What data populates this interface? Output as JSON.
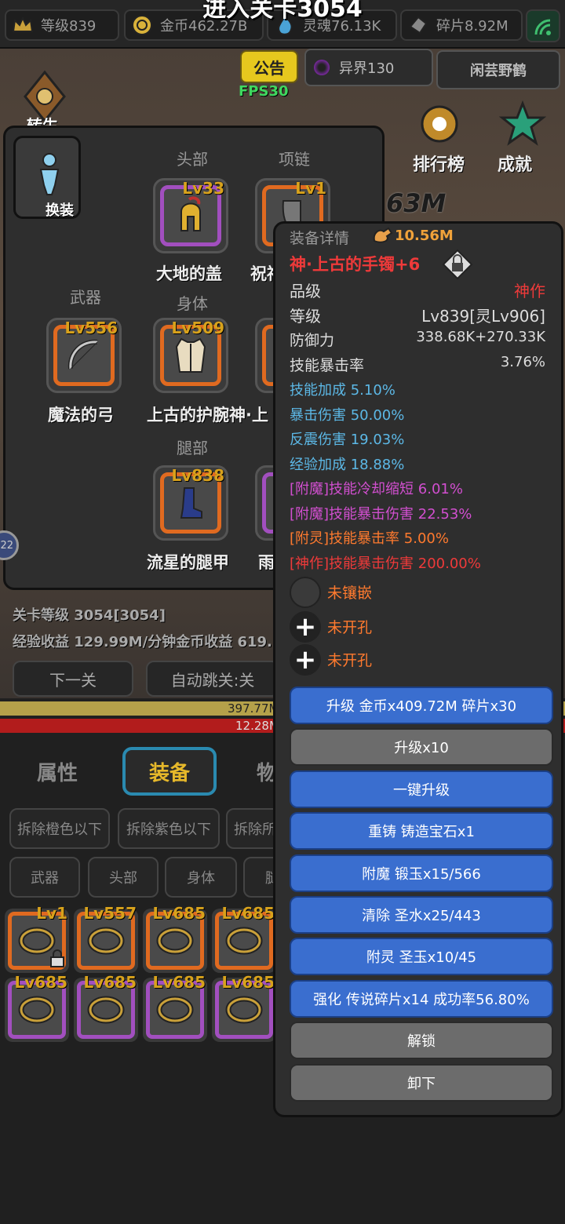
{
  "overlay_title": "进入关卡3054",
  "topbar": {
    "level": "等级839",
    "gold": "金币462.27B",
    "soul": "灵魂76.13K",
    "shard": "碎片8.92M"
  },
  "secondbar": {
    "notice": "公告",
    "otherworld": "异界130",
    "player": "闲芸野鹤",
    "fps": "FPS30"
  },
  "background_labels": {
    "rank": "排行榜",
    "achievement": "成就",
    "frag_value": "63M",
    "left_text": "转生"
  },
  "equip_panel": {
    "swap_label": "换装",
    "slots": [
      {
        "label": "头部",
        "level": "Lv33",
        "name": "大地的盖",
        "rarity": "purple"
      },
      {
        "label": "项链",
        "level": "Lv1",
        "name": "祝福",
        "rarity": "orange"
      },
      {
        "label": "武器",
        "level": "Lv556",
        "name": "魔法的弓",
        "rarity": "orange"
      },
      {
        "label": "身体",
        "level": "Lv509",
        "name": "上古的护腕神·上",
        "rarity": "orange"
      },
      {
        "label": "腿部",
        "level": "Lv838",
        "name": "流星的腿甲",
        "rarity": "orange"
      },
      {
        "label": "",
        "level": "",
        "name": "雨",
        "rarity": "purple"
      }
    ]
  },
  "stage": {
    "stage_level": "关卡等级 3054[3054]",
    "income": "经验收益 129.99M/分钟金币收益 619.",
    "next_button": "下一关",
    "auto_button": "自动跳关:关",
    "hp_bar_value": "397.77M",
    "red_bar_value": "12.28M",
    "round_badge": "22"
  },
  "tabs": [
    "属性",
    "装备",
    "物"
  ],
  "filters": {
    "row1": [
      "拆除橙色以下",
      "拆除紫色以下",
      "拆除所"
    ],
    "row2": [
      "武器",
      "头部",
      "身体",
      "腿"
    ]
  },
  "inventory": [
    {
      "level": "Lv1",
      "rarity": "orange",
      "locked": true
    },
    {
      "level": "Lv557",
      "rarity": "orange",
      "locked": false
    },
    {
      "level": "Lv685",
      "rarity": "orange",
      "locked": false
    },
    {
      "level": "Lv685",
      "rarity": "orange",
      "locked": false
    },
    {
      "level": "Lv685",
      "rarity": "purple",
      "locked": false
    },
    {
      "level": "Lv685",
      "rarity": "purple",
      "locked": false
    },
    {
      "level": "Lv685",
      "rarity": "purple",
      "locked": false
    },
    {
      "level": "Lv685",
      "rarity": "purple",
      "locked": false
    }
  ],
  "detail": {
    "header": "装备详情",
    "power": "10.56M",
    "item_name": "神·上古的手镯+6",
    "grade_label": "品级",
    "grade_value": "神作",
    "level_label": "等级",
    "level_value": "Lv839[灵Lv906]",
    "defense_label": "防御力",
    "defense_value": "338.68K+270.33K",
    "crit_label": "技能暴击率",
    "crit_value": "3.76%",
    "bonus_stats": [
      {
        "text": "技能加成 5.10%",
        "color": "#5cb8e6"
      },
      {
        "text": "暴击伤害 50.00%",
        "color": "#5cb8e6"
      },
      {
        "text": "反震伤害 19.03%",
        "color": "#5cb8e6"
      },
      {
        "text": "经验加成 18.88%",
        "color": "#5cb8e6"
      },
      {
        "text": "[附魔]技能冷却缩短 6.01%",
        "color": "#d24fd0"
      },
      {
        "text": "[附魔]技能暴击伤害 22.53%",
        "color": "#d24fd0"
      },
      {
        "text": "[附灵]技能暴击率 5.00%",
        "color": "#ff7a2e"
      },
      {
        "text": "[神作]技能暴击伤害 200.00%",
        "color": "#ee3a3a"
      }
    ],
    "sockets": [
      "未镶嵌",
      "未开孔",
      "未开孔"
    ],
    "actions": [
      {
        "label": "升级 金币x409.72M 碎片x30",
        "style": "blue"
      },
      {
        "label": "升级x10",
        "style": "gray"
      },
      {
        "label": "一键升级",
        "style": "blue"
      },
      {
        "label": "重铸 铸造宝石x1",
        "style": "blue"
      },
      {
        "label": "附魔 锻玉x15/566",
        "style": "blue"
      },
      {
        "label": "清除 圣水x25/443",
        "style": "blue"
      },
      {
        "label": "附灵 圣玉x10/45",
        "style": "blue"
      },
      {
        "label": "强化 传说碎片x14 成功率56.80%",
        "style": "blue"
      },
      {
        "label": "解锁",
        "style": "gray"
      },
      {
        "label": "卸下",
        "style": "gray"
      }
    ]
  },
  "colors": {
    "orange_rarity": "#e06a20",
    "purple_rarity": "#a24fbf",
    "level_gold": "#d8a21c",
    "item_name_red": "#ee3a3a",
    "grade_red": "#ee3a3a",
    "socket_text": "#ff7a2e",
    "blue_button": "#3a6ecf",
    "gray_button": "#6c6c6c"
  }
}
